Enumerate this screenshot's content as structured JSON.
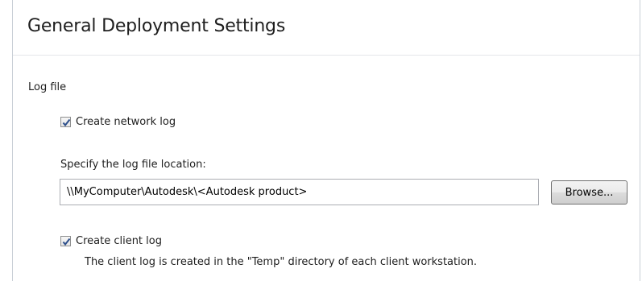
{
  "header": {
    "title": "General Deployment Settings"
  },
  "log_section": {
    "label": "Log file",
    "network_log": {
      "label": "Create network log",
      "checked": true
    },
    "location": {
      "label": "Specify the log file location:",
      "value": "\\\\MyComputer\\Autodesk\\<Autodesk product>",
      "browse_label": "Browse..."
    },
    "client_log": {
      "label": "Create client log",
      "checked": true,
      "description": "The client log is created in the \"Temp\" directory of each client workstation."
    }
  },
  "colors": {
    "checkmark": "#2d4f8b",
    "panel_border": "#c9cfd6"
  }
}
